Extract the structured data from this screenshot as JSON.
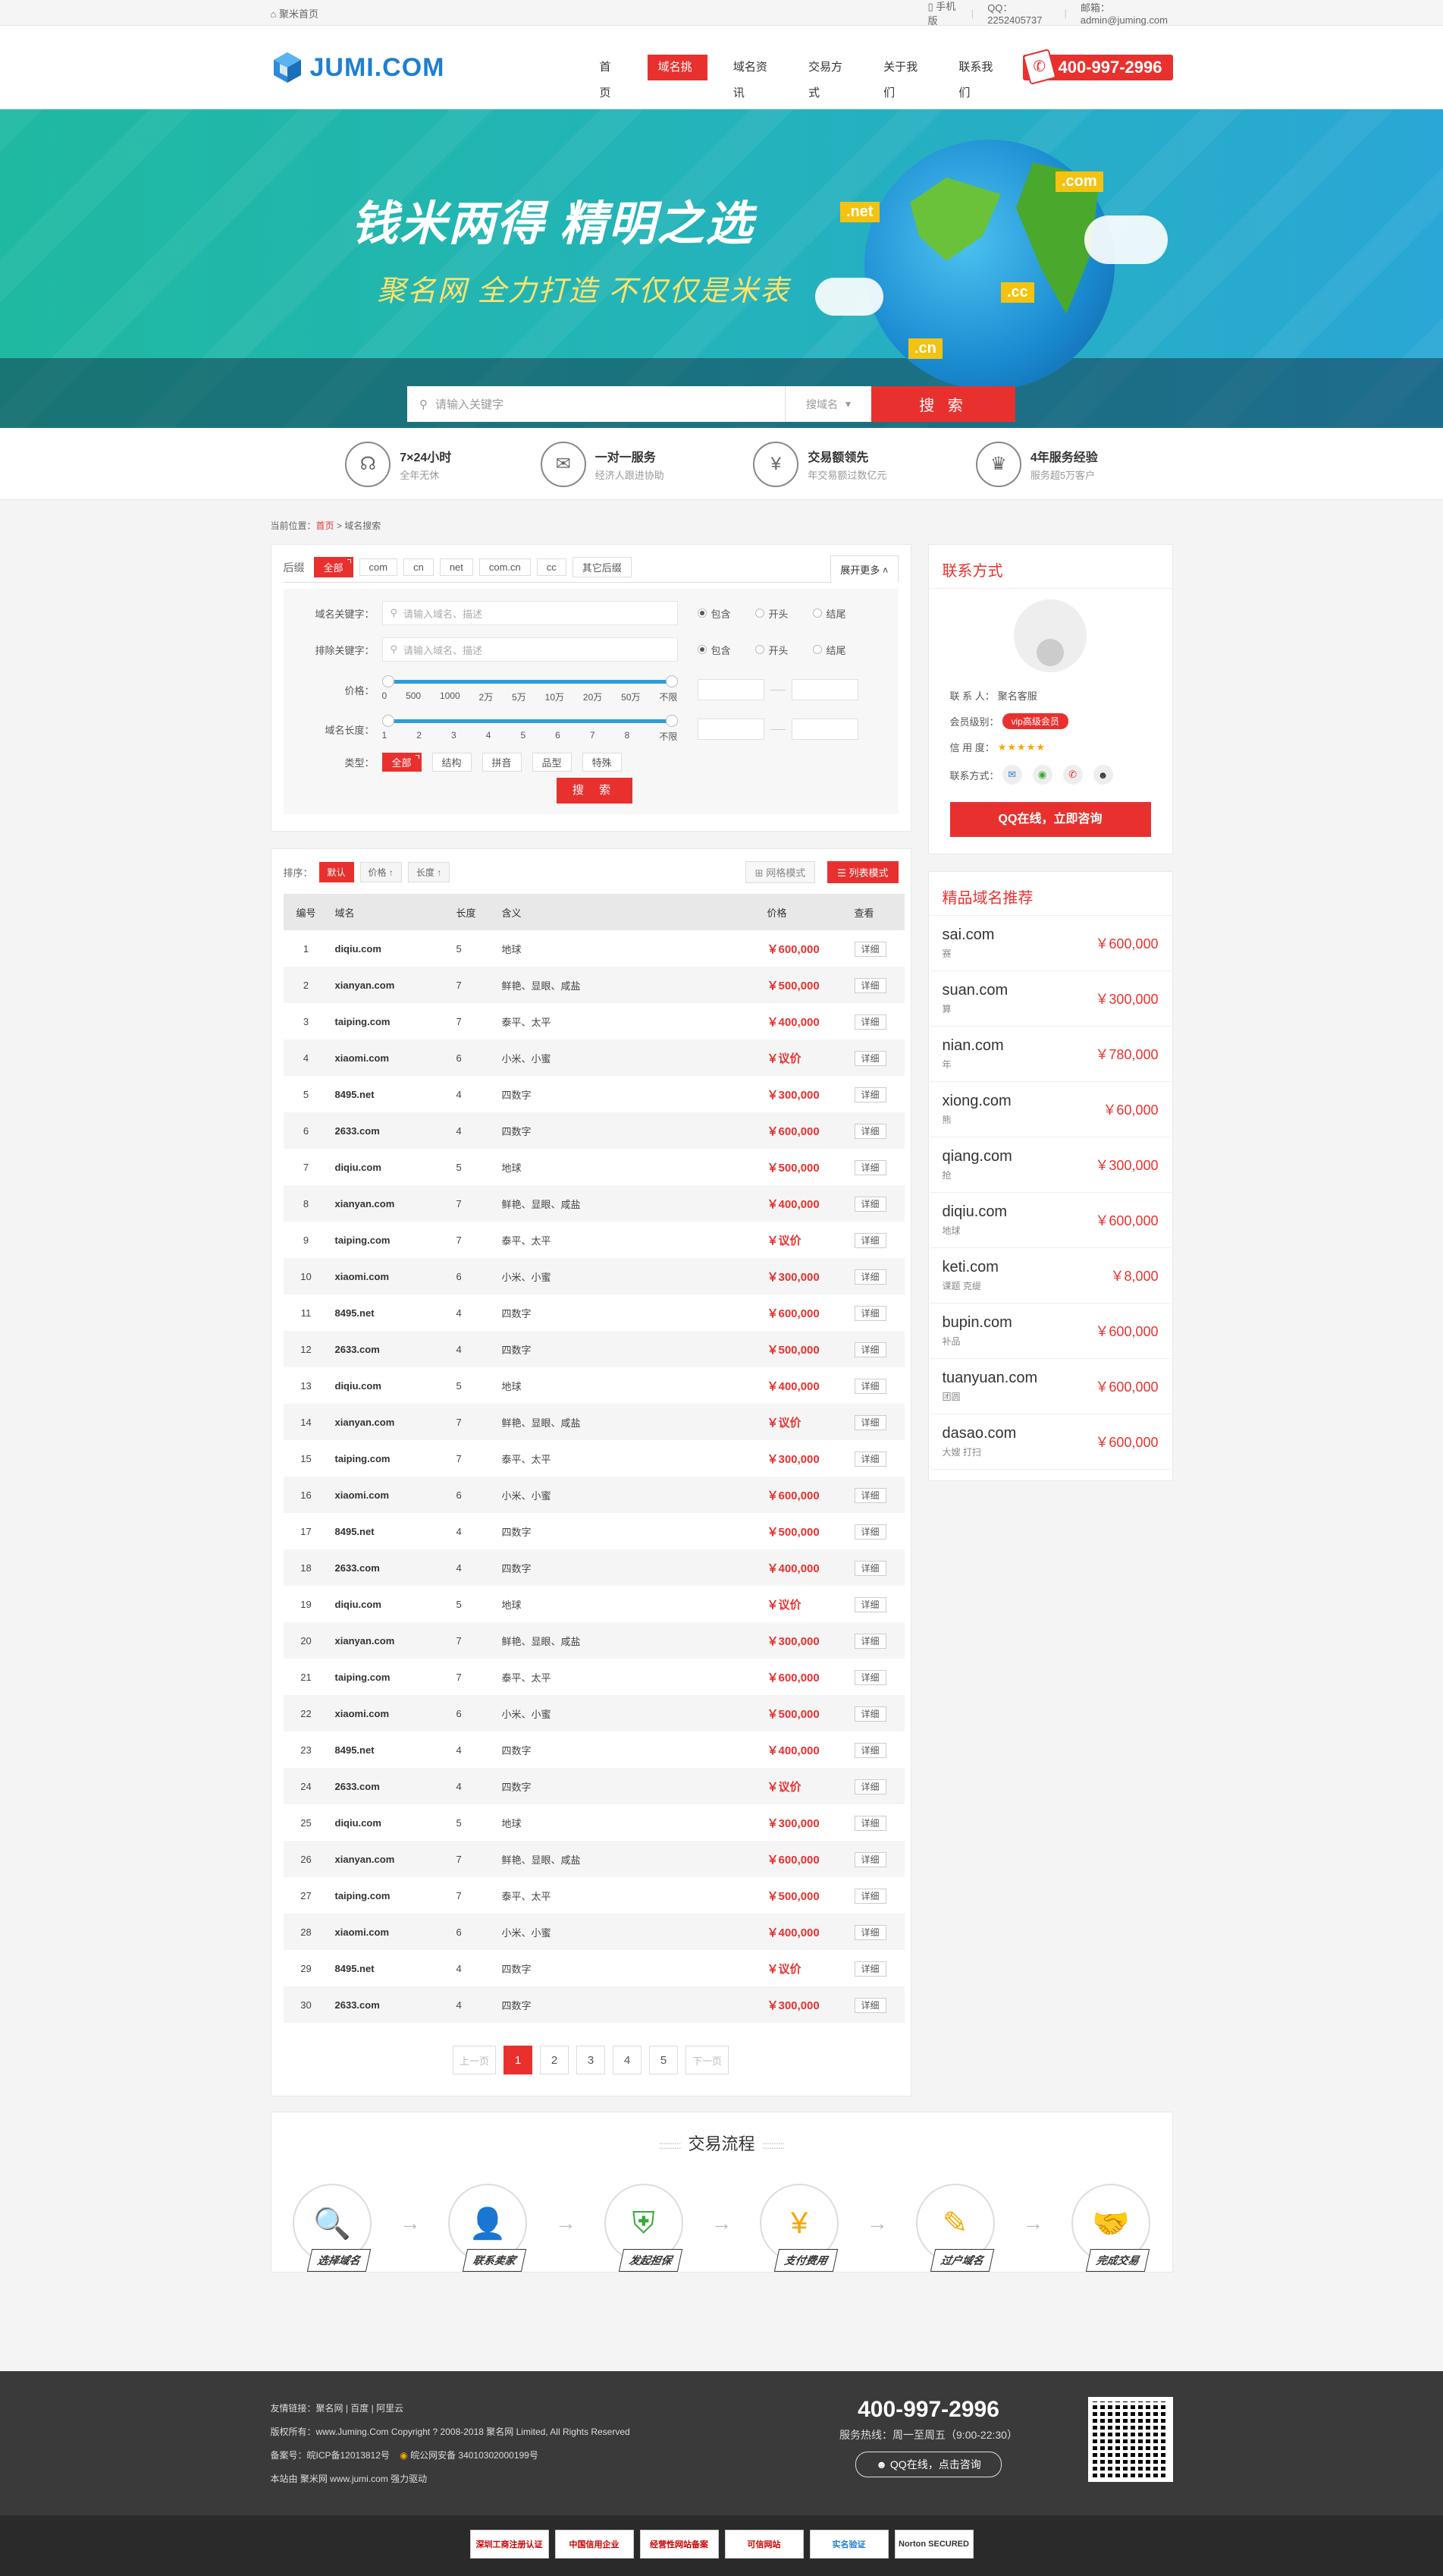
{
  "topbar": {
    "home": "聚米首页",
    "mobile": "手机版",
    "qq": "QQ：2252405737",
    "email": "邮箱：admin@juming.com"
  },
  "header": {
    "logo": "JUMI.COM",
    "phone": "400-997-2996",
    "nav": [
      "首 页",
      "域名挑选",
      "域名资讯",
      "交易方式",
      "关于我们",
      "联系我们"
    ]
  },
  "banner": {
    "title": "钱米两得  精明之选",
    "subtitle": "聚名网  全力打造  不仅仅是米表",
    "tags": [
      ".net",
      ".com",
      ".cc",
      ".cn"
    ],
    "search_placeholder": "请输入关键字",
    "search_select": "搜域名",
    "search_button": "搜 索"
  },
  "features": [
    {
      "t": "7×24小时",
      "s": "全年无休",
      "icon": "headset-icon"
    },
    {
      "t": "一对一服务",
      "s": "经济人跟进协助",
      "icon": "chat-icon"
    },
    {
      "t": "交易额领先",
      "s": "年交易额过数亿元",
      "icon": "yen-icon"
    },
    {
      "t": "4年服务经验",
      "s": "服务超5万客户",
      "icon": "trophy-icon"
    }
  ],
  "crumb": {
    "label": "当前位置：",
    "home": "首页",
    "current": "域名搜索"
  },
  "filter": {
    "suffix_label": "后缀",
    "suffixes": [
      "全部",
      "com",
      "cn",
      "net",
      "com.cn",
      "cc",
      "其它后缀"
    ],
    "more": "展开更多",
    "kw_label": "域名关键字：",
    "kw_placeholder": "请输入域名、描述",
    "ex_label": "排除关键字：",
    "ex_placeholder": "请输入域名、描述",
    "radios": [
      "包含",
      "开头",
      "结尾"
    ],
    "price_label": "价格：",
    "price_ticks": [
      "0",
      "500",
      "1000",
      "2万",
      "5万",
      "10万",
      "20万",
      "50万",
      "不限"
    ],
    "len_label": "域名长度：",
    "len_ticks": [
      "1",
      "2",
      "3",
      "4",
      "5",
      "6",
      "7",
      "8",
      "不限"
    ],
    "type_label": "类型：",
    "types": [
      "全部",
      "结构",
      "拼音",
      "品型",
      "特殊"
    ],
    "search": "搜 索"
  },
  "sort": {
    "label": "排序：",
    "default": "默认",
    "price": "价格 ↑",
    "length": "长度 ↑",
    "grid": "网格模式",
    "list": "列表模式"
  },
  "table": {
    "headers": [
      "编号",
      "域名",
      "长度",
      "含义",
      "价格",
      "查看"
    ],
    "detail": "详细",
    "rows": [
      [
        "1",
        "diqiu.com",
        "5",
        "地球",
        "￥600,000"
      ],
      [
        "2",
        "xianyan.com",
        "7",
        "鲜艳、显眼、咸盐",
        "￥500,000"
      ],
      [
        "3",
        "taiping.com",
        "7",
        "泰平、太平",
        "￥400,000"
      ],
      [
        "4",
        "xiaomi.com",
        "6",
        "小米、小蜜",
        "￥议价"
      ],
      [
        "5",
        "8495.net",
        "4",
        "四数字",
        "￥300,000"
      ],
      [
        "6",
        "2633.com",
        "4",
        "四数字",
        "￥600,000"
      ],
      [
        "7",
        "diqiu.com",
        "5",
        "地球",
        "￥500,000"
      ],
      [
        "8",
        "xianyan.com",
        "7",
        "鲜艳、显眼、咸盐",
        "￥400,000"
      ],
      [
        "9",
        "taiping.com",
        "7",
        "泰平、太平",
        "￥议价"
      ],
      [
        "10",
        "xiaomi.com",
        "6",
        "小米、小蜜",
        "￥300,000"
      ],
      [
        "11",
        "8495.net",
        "4",
        "四数字",
        "￥600,000"
      ],
      [
        "12",
        "2633.com",
        "4",
        "四数字",
        "￥500,000"
      ],
      [
        "13",
        "diqiu.com",
        "5",
        "地球",
        "￥400,000"
      ],
      [
        "14",
        "xianyan.com",
        "7",
        "鲜艳、显眼、咸盐",
        "￥议价"
      ],
      [
        "15",
        "taiping.com",
        "7",
        "泰平、太平",
        "￥300,000"
      ],
      [
        "16",
        "xiaomi.com",
        "6",
        "小米、小蜜",
        "￥600,000"
      ],
      [
        "17",
        "8495.net",
        "4",
        "四数字",
        "￥500,000"
      ],
      [
        "18",
        "2633.com",
        "4",
        "四数字",
        "￥400,000"
      ],
      [
        "19",
        "diqiu.com",
        "5",
        "地球",
        "￥议价"
      ],
      [
        "20",
        "xianyan.com",
        "7",
        "鲜艳、显眼、咸盐",
        "￥300,000"
      ],
      [
        "21",
        "taiping.com",
        "7",
        "泰平、太平",
        "￥600,000"
      ],
      [
        "22",
        "xiaomi.com",
        "6",
        "小米、小蜜",
        "￥500,000"
      ],
      [
        "23",
        "8495.net",
        "4",
        "四数字",
        "￥400,000"
      ],
      [
        "24",
        "2633.com",
        "4",
        "四数字",
        "￥议价"
      ],
      [
        "25",
        "diqiu.com",
        "5",
        "地球",
        "￥300,000"
      ],
      [
        "26",
        "xianyan.com",
        "7",
        "鲜艳、显眼、咸盐",
        "￥600,000"
      ],
      [
        "27",
        "taiping.com",
        "7",
        "泰平、太平",
        "￥500,000"
      ],
      [
        "28",
        "xiaomi.com",
        "6",
        "小米、小蜜",
        "￥400,000"
      ],
      [
        "29",
        "8495.net",
        "4",
        "四数字",
        "￥议价"
      ],
      [
        "30",
        "2633.com",
        "4",
        "四数字",
        "￥300,000"
      ]
    ]
  },
  "pager": {
    "prev": "上一页",
    "pages": [
      "1",
      "2",
      "3",
      "4",
      "5"
    ],
    "next": "下一页"
  },
  "contact": {
    "title": "联系方式",
    "name_label": "联 系 人：",
    "name": "聚名客服",
    "level_label": "会员级别：",
    "level": "vip高级会员",
    "credit_label": "信 用 度：",
    "stars": "★★★★★",
    "ways_label": "联系方式：",
    "qq_btn": "QQ在线，立即咨询"
  },
  "recommend": {
    "title": "精品域名推荐",
    "items": [
      {
        "n": "sai.com",
        "m": "赛",
        "p": "￥600,000"
      },
      {
        "n": "suan.com",
        "m": "算",
        "p": "￥300,000"
      },
      {
        "n": "nian.com",
        "m": "年",
        "p": "￥780,000"
      },
      {
        "n": "xiong.com",
        "m": "熊",
        "p": "￥60,000"
      },
      {
        "n": "qiang.com",
        "m": "抢",
        "p": "￥300,000"
      },
      {
        "n": "diqiu.com",
        "m": "地球",
        "p": "￥600,000"
      },
      {
        "n": "keti.com",
        "m": "课题 克缇",
        "p": "￥8,000"
      },
      {
        "n": "bupin.com",
        "m": "补品",
        "p": "￥600,000"
      },
      {
        "n": "tuanyuan.com",
        "m": "团圆",
        "p": "￥600,000"
      },
      {
        "n": "dasao.com",
        "m": "大嫂 打扫",
        "p": "￥600,000"
      }
    ]
  },
  "process": {
    "title": "交易流程",
    "steps": [
      "选择域名",
      "联系卖家",
      "发起担保",
      "支付费用",
      "过户域名",
      "完成交易"
    ]
  },
  "footer": {
    "links": "友情链接：聚名网 | 百度 | 阿里云",
    "copy": "版权所有：www.Juming.Com   Copyright ? 2008-2018 聚名网 Limited, All Rights Reserved",
    "icp": "备案号：皖ICP备12013812号",
    "police": "皖公网安备 34010302000199号",
    "powered": "本站由 聚米网 www.jumi.com 强力驱动",
    "phone": "400-997-2996",
    "hours": "服务热线：周一至周五（9:00-22:30）",
    "qq": "QQ在线，点击咨询",
    "badges": [
      "深圳工商注册认证",
      "中国信用企业",
      "经营性网站备案",
      "可信网站",
      "实名验证",
      "Norton SECURED"
    ]
  }
}
